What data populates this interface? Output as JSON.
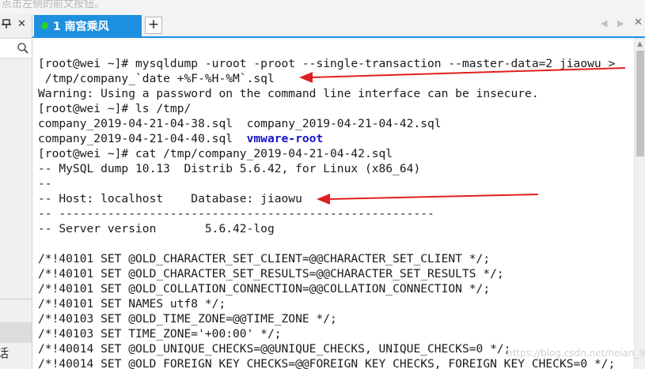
{
  "top_hint": "点击左侧的前文按钮。",
  "left_pane": {
    "pin_icon": "pin-icon",
    "close_label": "✕",
    "search_icon": "search-icon",
    "cut_text": "话"
  },
  "tabs": {
    "active": {
      "label": "1 南宫乘风",
      "status_color": "#28d228"
    },
    "add_label": "+",
    "accent": "#1e90e0"
  },
  "terminal": {
    "lines": [
      "[root@wei ~]# mysqldump -uroot -proot --single-transaction --master-data=2 jiaowu >",
      " /tmp/company_`date +%F-%H-%M`.sql",
      "Warning: Using a password on the command line interface can be insecure.",
      "[root@wei ~]# ls /tmp/",
      "company_2019-04-21-04-38.sql  company_2019-04-21-04-42.sql",
      "company_2019-04-21-04-40.sql  ",
      "[root@wei ~]# cat /tmp/company_2019-04-21-04-42.sql",
      "-- MySQL dump 10.13  Distrib 5.6.42, for Linux (x86_64)",
      "--",
      "-- Host: localhost    Database: jiaowu",
      "-- ------------------------------------------------------",
      "-- Server version\t5.6.42-log",
      "",
      "/*!40101 SET @OLD_CHARACTER_SET_CLIENT=@@CHARACTER_SET_CLIENT */;",
      "/*!40101 SET @OLD_CHARACTER_SET_RESULTS=@@CHARACTER_SET_RESULTS */;",
      "/*!40101 SET @OLD_COLLATION_CONNECTION=@@COLLATION_CONNECTION */;",
      "/*!40101 SET NAMES utf8 */;",
      "/*!40103 SET @OLD_TIME_ZONE=@@TIME_ZONE */;",
      "/*!40103 SET TIME_ZONE='+00:00' */;",
      "/*!40014 SET @OLD_UNIQUE_CHECKS=@@UNIQUE_CHECKS, UNIQUE_CHECKS=0 */;",
      "/*!40014 SET @OLD_FOREIGN_KEY_CHECKS=@@FOREIGN_KEY_CHECKS, FOREIGN_KEY_CHECKS=0 */;"
    ],
    "highlight": "vmware-root",
    "highlight_color": "#1414c8"
  },
  "annotation_color": "#e02020",
  "watermark": "https://blog.csdn.net/heian_99"
}
